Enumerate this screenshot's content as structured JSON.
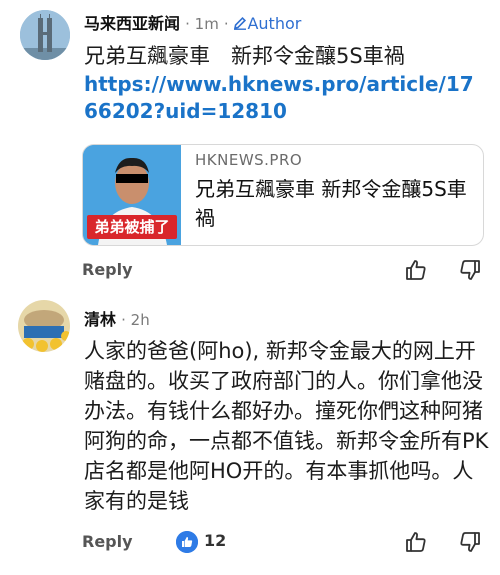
{
  "comment1": {
    "author": "马来西亚新闻",
    "time": "1m",
    "tag": "Author",
    "title_line": "兄弟互飆豪車　新邦令金釀5S車禍",
    "link": "https://www.hknews.pro/article/1766202?uid=12810",
    "card": {
      "domain": "HKNEWS.PRO",
      "title": "兄弟互飆豪車 新邦令金釀5S車禍",
      "thumb_caption": "弟弟被捕了"
    },
    "reply_label": "Reply"
  },
  "comment2": {
    "author": "清林",
    "time": "2h",
    "text": "人家的爸爸(阿ho), 新邦令金最大的网上开赌盘的。收买了政府部门的人。你们拿他没办法。有钱什么都好办。撞死你們这种阿猪阿狗的命，一点都不值钱。新邦令金所有PK店名都是他阿HO开的。有本事抓他吗。人家有的是钱",
    "reply_label": "Reply",
    "like_count": "12"
  },
  "icons": [
    "pencil-icon",
    "thumbs-up-icon",
    "thumbs-down-icon",
    "like-badge-icon"
  ],
  "colors": {
    "link": "#1a73c8",
    "author_tag": "#2f6fd1",
    "like_badge": "#2e7be6",
    "thumb_caption_bg": "#d9262b"
  }
}
